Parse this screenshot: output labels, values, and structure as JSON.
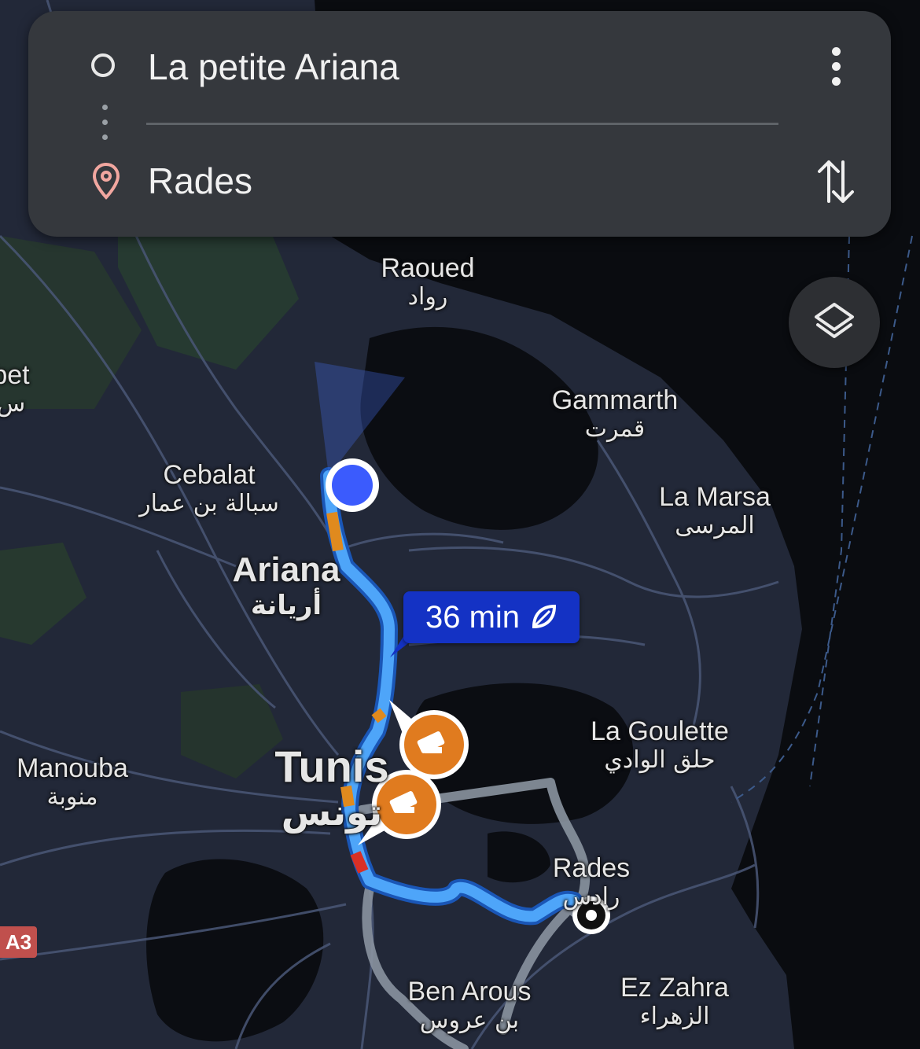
{
  "directions": {
    "origin": "La petite Ariana",
    "destination": "Rades"
  },
  "route": {
    "eta": "36 min"
  },
  "map": {
    "places": [
      {
        "id": "raoued",
        "en": "Raoued",
        "ar": "رواد"
      },
      {
        "id": "gammarth",
        "en": "Gammarth",
        "ar": "قمرت"
      },
      {
        "id": "cebalat",
        "en": "Cebalat",
        "ar": "سبالة بن عمار"
      },
      {
        "id": "la-marsa",
        "en": "La Marsa",
        "ar": "المرسى"
      },
      {
        "id": "ariana",
        "en": "Ariana",
        "ar": "أريانة"
      },
      {
        "id": "la-goulette",
        "en": "La Goulette",
        "ar": "حلق الوادي"
      },
      {
        "id": "tunis",
        "en": "Tunis",
        "ar": "تونس"
      },
      {
        "id": "manouba",
        "en": "Manouba",
        "ar": "منوبة"
      },
      {
        "id": "rades",
        "en": "Rades",
        "ar": "رادس"
      },
      {
        "id": "ben-arous",
        "en": "Ben Arous",
        "ar": "بن عروس"
      },
      {
        "id": "ez-zahra",
        "en": "Ez Zahra",
        "ar": "الزهراء"
      }
    ],
    "edge_label": {
      "en": "bet",
      "ar": "س"
    },
    "road_shield": "A3"
  },
  "colors": {
    "route": "#4ea5f9",
    "alt_route": "#8a93a0",
    "traffic_slow": "#e08a1e",
    "traffic_jam": "#d93025",
    "eta_badge": "#1432c4",
    "camera_badge": "#e07b1f",
    "card": "#35383d",
    "location_dot": "#3b5bfd"
  },
  "icons": [
    "more-vert-icon",
    "swap-icon",
    "location-pin-icon",
    "origin-circle-icon",
    "layers-icon",
    "eco-leaf-icon",
    "speed-camera-icon",
    "destination-marker-icon",
    "current-location-icon"
  ]
}
